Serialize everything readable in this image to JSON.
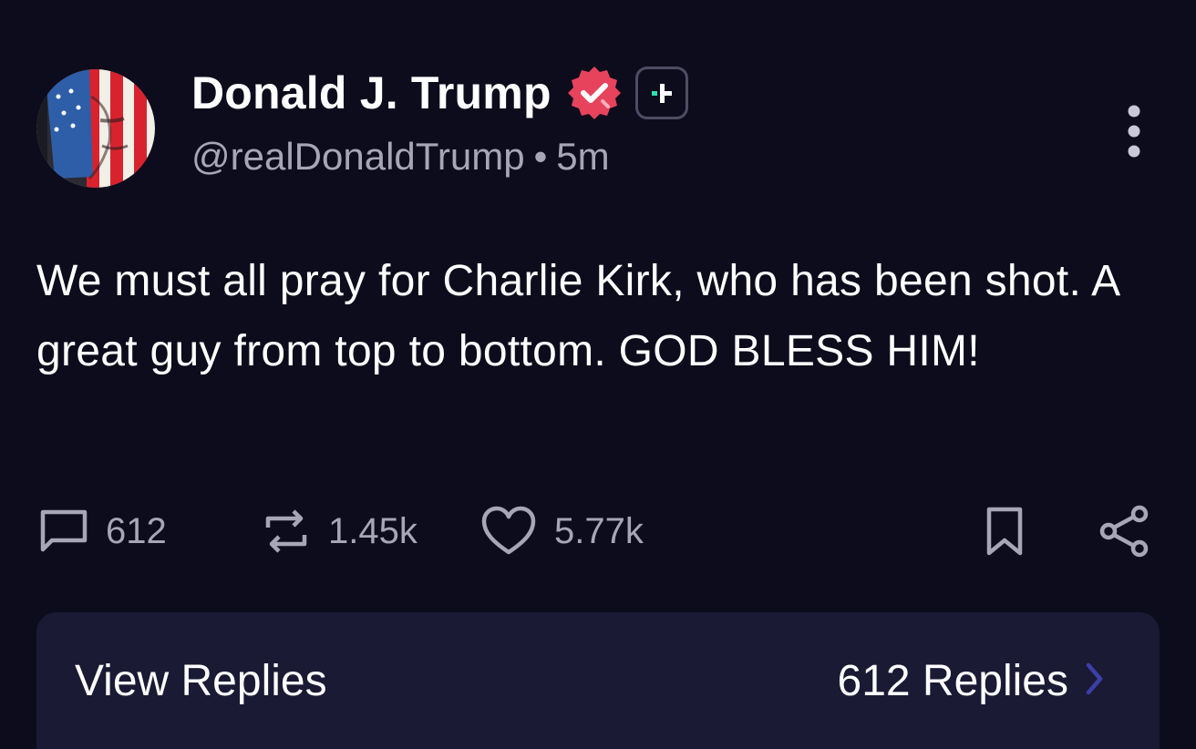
{
  "author": {
    "display_name": "Donald J. Trump",
    "handle": "@realDonaldTrump",
    "separator": "•",
    "time_ago": "5m"
  },
  "post": {
    "text": "We must all pray for Charlie Kirk, who has been shot. A great guy from top to bottom. GOD BLESS HIM!"
  },
  "actions": {
    "replies": "612",
    "reposts": "1.45k",
    "likes": "5.77k"
  },
  "replies_bar": {
    "label": "View Replies",
    "count": "612 Replies"
  },
  "icons": {
    "verified": "verified-badge-icon",
    "plus": "plus-badge-icon",
    "more": "more-vertical-icon",
    "reply": "comment-icon",
    "repost": "repost-icon",
    "like": "heart-icon",
    "bookmark": "bookmark-icon",
    "share": "share-icon",
    "chevron": "chevron-right-icon"
  },
  "colors": {
    "background": "#0d0c1c",
    "verified": "#e8435c",
    "muted_text": "#a7a6b6",
    "replies_bar": "#1b1a35",
    "plus_accent": "#2fe0b0"
  }
}
